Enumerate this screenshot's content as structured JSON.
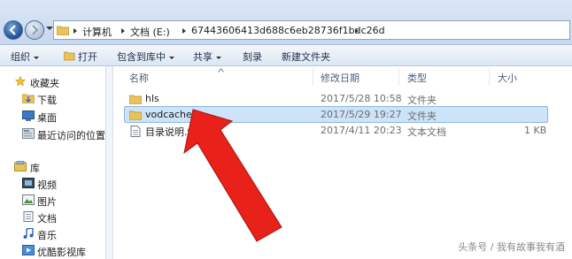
{
  "address": {
    "crumbs": [
      "计算机",
      "文档 (E:)",
      "67443606413d688c6eb28736f1bdc26d"
    ]
  },
  "toolbar": {
    "organize": "组织",
    "open": "打开",
    "include_in_library": "包含到库中",
    "share": "共享",
    "burn": "刻录",
    "new_folder": "新建文件夹"
  },
  "navpane": {
    "favorites": {
      "title": "收藏夹",
      "items": [
        "下载",
        "桌面",
        "最近访问的位置"
      ]
    },
    "libraries": {
      "title": "库",
      "items": [
        "视频",
        "图片",
        "文档",
        "音乐",
        "优酷影视库"
      ]
    }
  },
  "content": {
    "columns": {
      "name": "名称",
      "date": "修改日期",
      "type": "类型",
      "size": "大小"
    },
    "rows": [
      {
        "name": "hls",
        "date": "2017/5/28 10:58",
        "type": "文件夹",
        "size": ""
      },
      {
        "name": "vodcache",
        "date": "2017/5/29 19:27",
        "type": "文件夹",
        "size": ""
      },
      {
        "name": "目录说明.txt",
        "date": "2017/4/11 20:23",
        "type": "文本文档",
        "size": "1 KB"
      }
    ]
  },
  "watermark": "头条号 / 我有故事我有酒",
  "colors": {
    "selection": "#cde3f9",
    "arrow": "#e8211a",
    "folder": "#e9c25a"
  },
  "icons": [
    "back-icon",
    "forward-icon",
    "folder-icon",
    "star-icon",
    "download-icon",
    "desktop-icon",
    "recent-icon",
    "library-icon",
    "video-icon",
    "picture-icon",
    "document-icon",
    "music-icon",
    "text-file-icon"
  ]
}
